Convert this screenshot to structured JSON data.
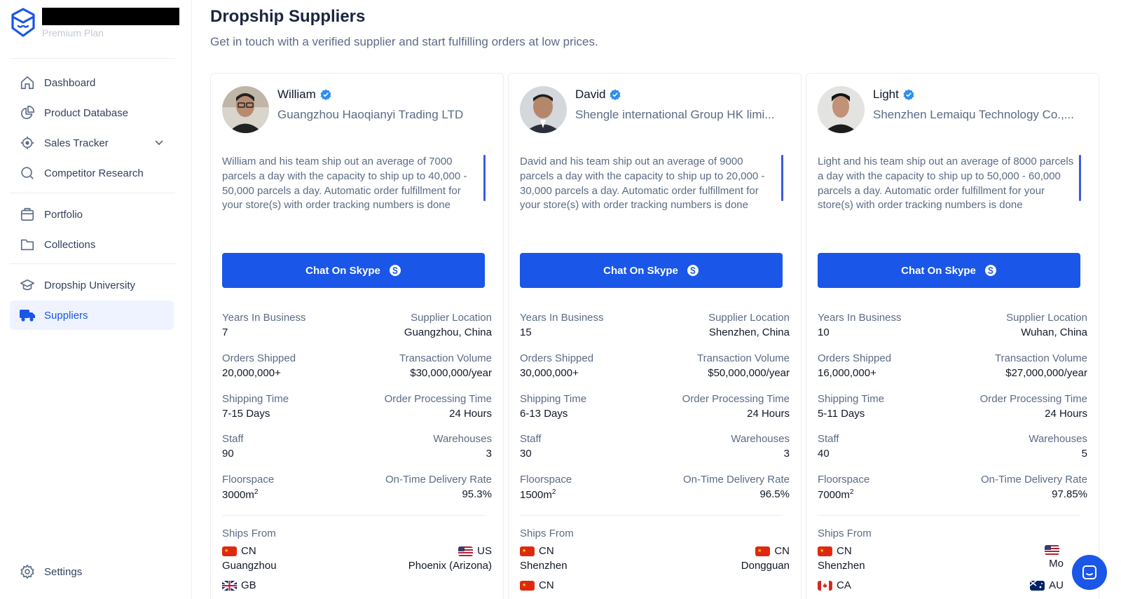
{
  "brand": {
    "plan": "Premium Plan"
  },
  "nav": {
    "dashboard": "Dashboard",
    "product_database": "Product Database",
    "sales_tracker": "Sales Tracker",
    "competitor_research": "Competitor Research",
    "portfolio": "Portfolio",
    "collections": "Collections",
    "dropship_university": "Dropship University",
    "suppliers": "Suppliers",
    "settings": "Settings"
  },
  "page": {
    "title": "Dropship Suppliers",
    "subtitle": "Get in touch with a verified supplier and start fulfilling orders at low prices."
  },
  "labels": {
    "chat_button": "Chat On Skype",
    "years": "Years In Business",
    "location": "Supplier Location",
    "orders": "Orders Shipped",
    "volume": "Transaction Volume",
    "shipping": "Shipping Time",
    "processing": "Order Processing Time",
    "staff": "Staff",
    "warehouses": "Warehouses",
    "floorspace": "Floorspace",
    "ontime": "On-Time Delivery Rate",
    "ships_from": "Ships From",
    "floor_unit": "m",
    "floor_sup": "2"
  },
  "suppliers": [
    {
      "name": "William",
      "company": "Guangzhou Haoqianyi Trading LTD",
      "description": "William and his team ship out an average of 7000 parcels a day with the capacity to ship up to 40,000 - 50,000 parcels a day. Automatic order fulfillment for your store(s) with order tracking numbers is done",
      "years": "7",
      "location": "Guangzhou, China",
      "orders": "20,000,000+",
      "volume": "$30,000,000/year",
      "shipping": "7-15 Days",
      "processing": "24 Hours",
      "staff": "90",
      "warehouses": "3",
      "floorspace": "3000",
      "ontime": "95.3%",
      "ships": [
        {
          "code": "CN",
          "city": "Guangzhou",
          "flag": "cn"
        },
        {
          "code": "US",
          "city": "Phoenix (Arizona)",
          "flag": "us"
        },
        {
          "code": "GB",
          "city": "",
          "flag": "gb"
        }
      ]
    },
    {
      "name": "David",
      "company": "Shengle international Group HK limi...",
      "description": "David and his team ship out an average of 9000 parcels a day with the capacity to ship up to 20,000 - 30,000 parcels a day. Automatic order fulfillment for your store(s) with order tracking numbers is done",
      "years": "15",
      "location": "Shenzhen, China",
      "orders": "30,000,000+",
      "volume": "$50,000,000/year",
      "shipping": "6-13 Days",
      "processing": "24 Hours",
      "staff": "30",
      "warehouses": "3",
      "floorspace": "1500",
      "ontime": "96.5%",
      "ships": [
        {
          "code": "CN",
          "city": "Shenzhen",
          "flag": "cn"
        },
        {
          "code": "CN",
          "city": "Dongguan",
          "flag": "cn"
        },
        {
          "code": "CN",
          "city": "",
          "flag": "cn"
        }
      ]
    },
    {
      "name": "Light",
      "company": "Shenzhen Lemaiqu Technology Co.,...",
      "description": "Light and his team ship out an average of 8000 parcels a day with the capacity to ship up to 50,000 - 60,000 parcels a day. Automatic order fulfillment for your store(s) with order tracking numbers is done",
      "years": "10",
      "location": "Wuhan, China",
      "orders": "16,000,000+",
      "volume": "$27,000,000/year",
      "shipping": "5-11 Days",
      "processing": "24 Hours",
      "staff": "40",
      "warehouses": "5",
      "floorspace": "7000",
      "ontime": "97.85%",
      "ships": [
        {
          "code": "CN",
          "city": "Shenzhen",
          "flag": "cn"
        },
        {
          "code": "",
          "city": "Mo",
          "flag": "us"
        },
        {
          "code": "CA",
          "city": "",
          "flag": "ca"
        },
        {
          "code": "AU",
          "city": "",
          "flag": "au"
        }
      ]
    }
  ],
  "colors": {
    "accent": "#1a56e8",
    "active_bg": "#eef3ff",
    "muted": "#5c6b86"
  }
}
